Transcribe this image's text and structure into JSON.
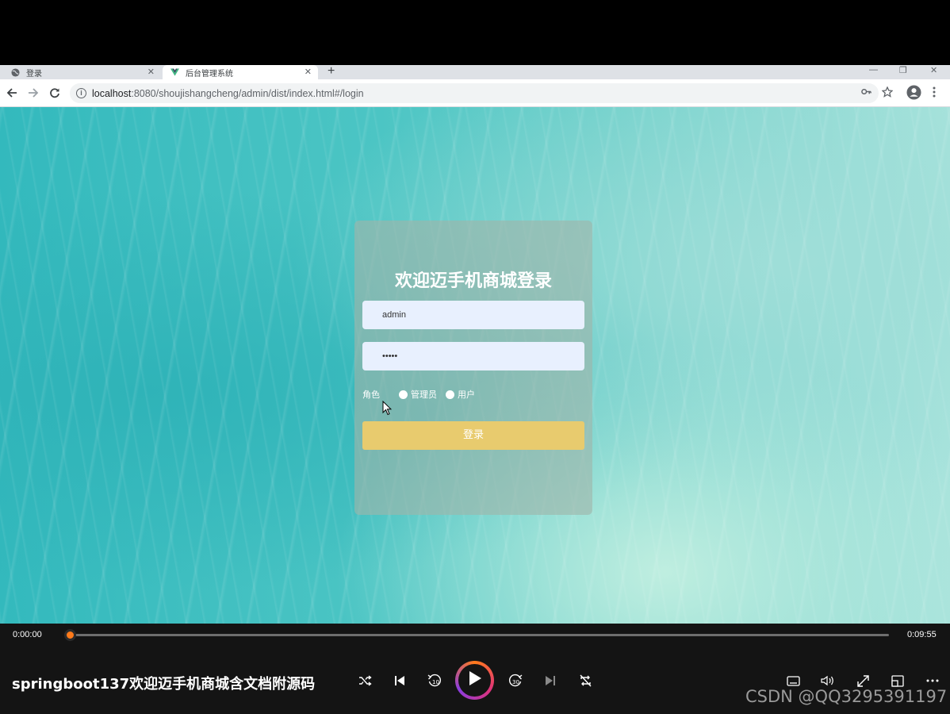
{
  "browser": {
    "tabs": [
      {
        "label": "登录",
        "active": false
      },
      {
        "label": "后台管理系统",
        "active": true
      }
    ],
    "url_host": "localhost",
    "url_path": ":8080/shoujishangcheng/admin/dist/index.html#/login"
  },
  "login": {
    "title": "欢迎迈手机商城登录",
    "username_value": "admin",
    "password_value": "•••••",
    "role_label": "角色",
    "roles": [
      "管理员",
      "用户"
    ],
    "button_label": "登录",
    "button_color": "#e8cb6e"
  },
  "player": {
    "current_time": "0:00:00",
    "total_time": "0:09:55",
    "progress": 0.0,
    "video_title": "springboot137欢迎迈手机商城含文档附源码",
    "accent_color": "#ff7a1a"
  },
  "watermark": "CSDN @QQ3295391197",
  "icons": [
    "globe-icon",
    "vue-logo-icon",
    "back-icon",
    "forward-icon",
    "reload-icon",
    "info-icon",
    "key-icon",
    "star-icon",
    "profile-icon",
    "menu-icon",
    "shuffle-icon",
    "previous-icon",
    "rewind-10-icon",
    "play-icon",
    "forward-30-icon",
    "next-icon",
    "repeat-icon",
    "subtitles-icon",
    "volume-icon",
    "fullscreen-icon",
    "miniplayer-icon",
    "more-icon"
  ]
}
